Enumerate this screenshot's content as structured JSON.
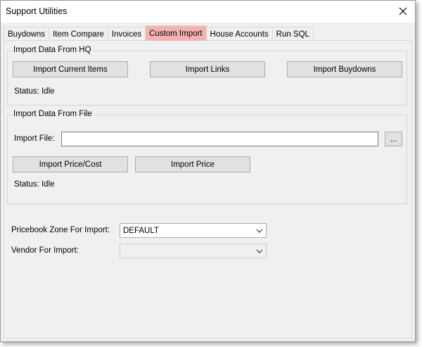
{
  "window": {
    "title": "Support Utilities"
  },
  "tabs": [
    {
      "label": "Buydowns",
      "active": false
    },
    {
      "label": "Item Compare",
      "active": false
    },
    {
      "label": "Invoices",
      "active": false
    },
    {
      "label": "Custom Import",
      "active": true
    },
    {
      "label": "House Accounts",
      "active": false
    },
    {
      "label": "Run SQL",
      "active": false
    }
  ],
  "colors": {
    "active_tab": "#f6b2b2",
    "client_bg": "#f0f0f0"
  },
  "hq_group": {
    "title": "Import Data From HQ",
    "buttons": {
      "import_current_items": "Import Current Items",
      "import_links": "Import Links",
      "import_buydowns": "Import Buydowns"
    },
    "status": "Status: Idle"
  },
  "file_group": {
    "title": "Import Data From File",
    "file_label": "Import File:",
    "file_value": "",
    "browse_label": "...",
    "buttons": {
      "import_price_cost": "Import Price/Cost",
      "import_price": "Import Price"
    },
    "status": "Status: Idle"
  },
  "pricebook": {
    "label": "Pricebook Zone For Import:",
    "value": "DEFAULT"
  },
  "vendor": {
    "label": "Vendor For Import:",
    "value": ""
  },
  "icons": {
    "close": "close-icon",
    "dropdown": "chevron-down-icon"
  }
}
